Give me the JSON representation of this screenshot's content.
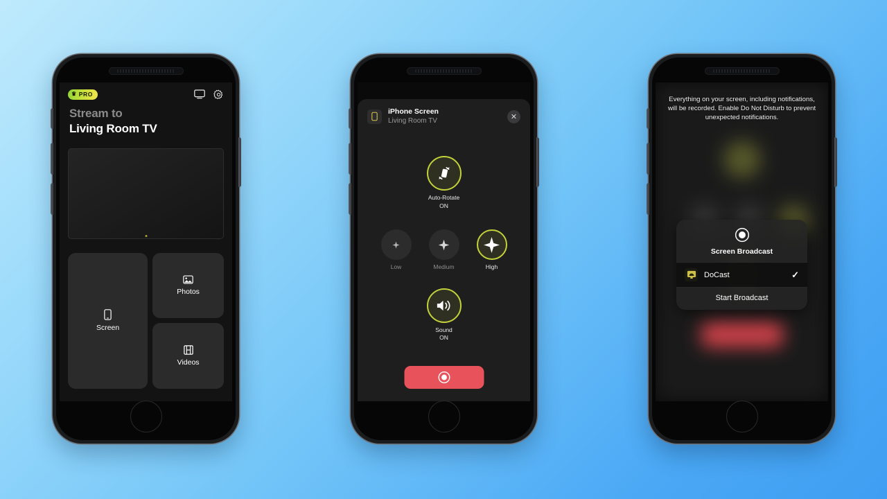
{
  "background": {
    "from": "#bfeafc",
    "to": "#3f9ef2"
  },
  "accent": {
    "lime": "#c3d23a",
    "red": "#e8535b",
    "pro_from": "#8fd53a",
    "pro_to": "#f2e24b"
  },
  "phone1": {
    "name": "DoCast app home screen",
    "topbar": {
      "pro_badge": "PRO",
      "crown_icon": "crown-icon",
      "tv_icon": "tv-icon",
      "settings_icon": "gear-icon"
    },
    "heading": {
      "line1": "Stream to",
      "line2": "Living Room TV"
    },
    "preview": {
      "label": "tv-preview"
    },
    "tiles": [
      {
        "label": "Screen",
        "icon": "phone-icon"
      },
      {
        "label": "Photos",
        "icon": "photo-icon"
      },
      {
        "label": "Videos",
        "icon": "film-icon"
      }
    ]
  },
  "phone2": {
    "name": "Screen mirroring control sheet",
    "header": {
      "app_icon": "phone-screen-icon",
      "title": "iPhone Screen",
      "subtitle": "Living Room TV",
      "close_icon": "close-icon"
    },
    "auto_rotate": {
      "icon": "rotate-phone-icon",
      "label": "Auto-Rotate",
      "value": "ON",
      "active": true
    },
    "quality": [
      {
        "label": "Low",
        "icon": "sparkle-icon",
        "active": false
      },
      {
        "label": "Medium",
        "icon": "sparkle-icon",
        "active": false
      },
      {
        "label": "High",
        "icon": "sparkle-icon",
        "active": true
      }
    ],
    "sound": {
      "icon": "speaker-wave-icon",
      "label": "Sound",
      "value": "ON",
      "active": true
    },
    "record_button": {
      "icon": "record-icon",
      "color": "#e8535b"
    }
  },
  "phone3": {
    "name": "iOS screen broadcast permission dialog",
    "notice": "Everything on your screen, including notifications, will be recorded. Enable Do Not Disturb to prevent unexpected notifications.",
    "dialog": {
      "icon": "record-target-icon",
      "title": "Screen Broadcast",
      "app": {
        "name": "DoCast",
        "icon": "docast-icon",
        "selected_icon": "check-icon",
        "selected": true
      },
      "start_button": "Start Broadcast"
    }
  }
}
